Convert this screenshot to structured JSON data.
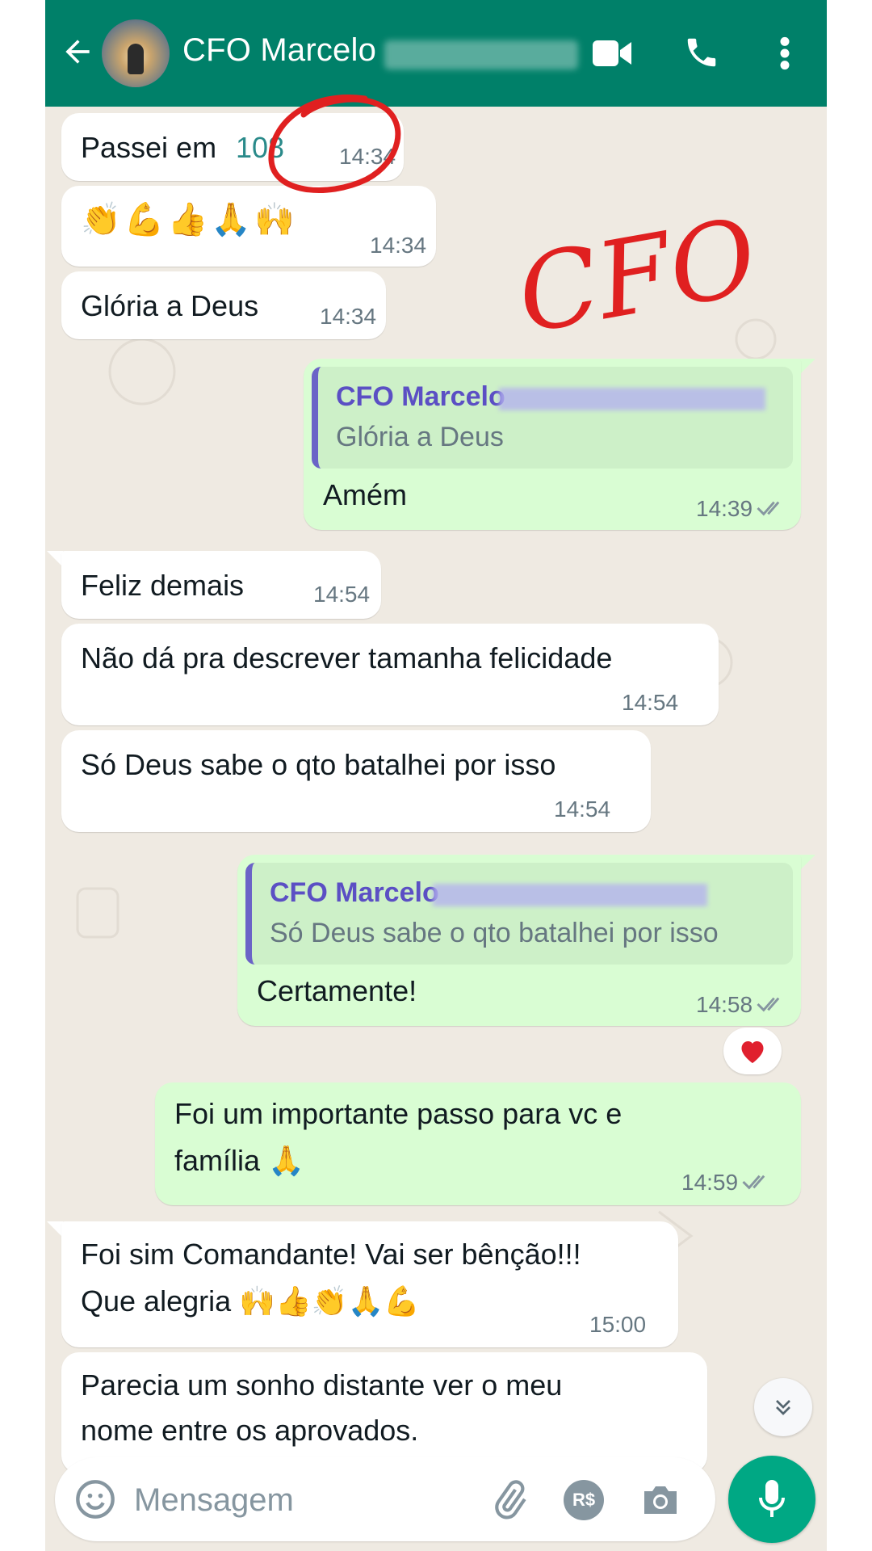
{
  "header": {
    "contact_name": "CFO Marcelo"
  },
  "messages": [
    {
      "dir": "in",
      "text": "Passei em",
      "highlight": "108",
      "time": "14:34"
    },
    {
      "dir": "in",
      "text": "👏💪👍🙏🙌",
      "time": "14:34"
    },
    {
      "dir": "in",
      "text": "Glória a Deus",
      "time": "14:34"
    },
    {
      "dir": "out",
      "quote_name": "CFO Marcelo",
      "quote_text": "Glória a Deus",
      "text": "Amém",
      "time": "14:39"
    },
    {
      "dir": "in",
      "text": "Feliz demais",
      "time": "14:54"
    },
    {
      "dir": "in",
      "text": "Não dá pra descrever tamanha felicidade",
      "time": "14:54"
    },
    {
      "dir": "in",
      "text": "Só Deus sabe o qto batalhei por isso",
      "time": "14:54"
    },
    {
      "dir": "out",
      "quote_name": "CFO Marcelo",
      "quote_text": "Só Deus sabe o qto batalhei por isso",
      "text": "Certamente!",
      "time": "14:58",
      "reaction": "❤️"
    },
    {
      "dir": "out",
      "text_line1": "Foi um importante passo para vc e",
      "text_line2": "família 🙏",
      "time": "14:59"
    },
    {
      "dir": "in",
      "text_line1": "Foi sim Comandante! Vai ser bênção!!!",
      "text_line2": "Que alegria 🙌👍👏🙏💪",
      "time": "15:00"
    },
    {
      "dir": "in",
      "text_line1": "Parecia um sonho distante ver o meu",
      "text_line2": "nome entre os aprovados."
    }
  ],
  "annotation_text": "CFO",
  "composer": {
    "placeholder": "Mensagem",
    "pay_label": "R$"
  },
  "colors": {
    "header": "#008069",
    "outgoing_bubble": "#d9fdd3",
    "incoming_bubble": "#ffffff",
    "mic_button": "#00a884",
    "annotation": "#e02020"
  }
}
